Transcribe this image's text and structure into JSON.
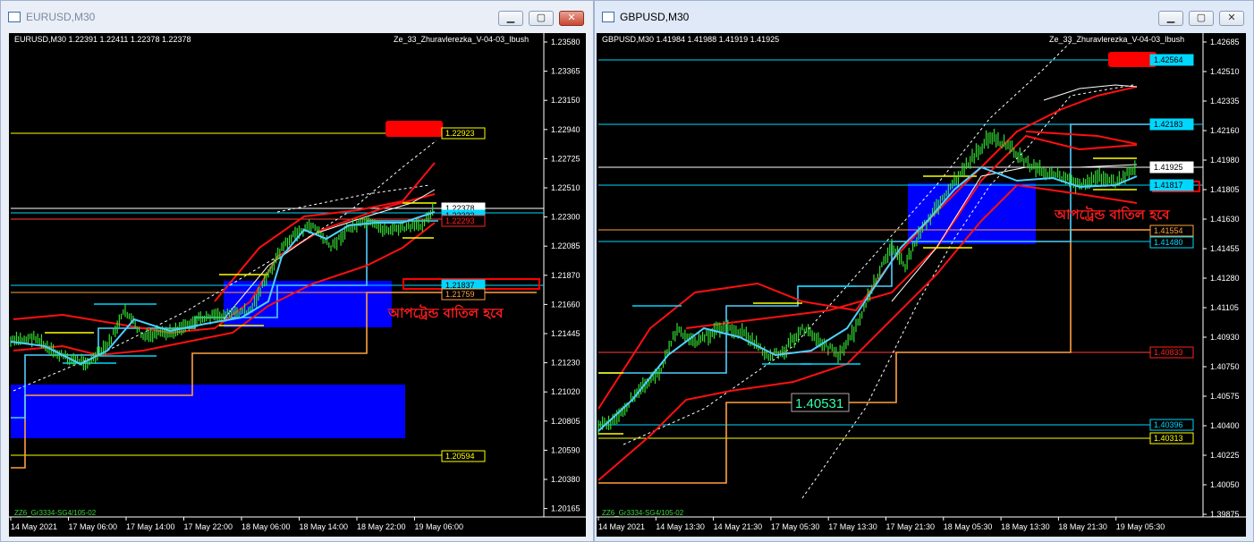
{
  "left": {
    "window_title": "EURUSD,M30",
    "info_line": "EURUSD,M30  1.22391 1.22411 1.22378 1.22378",
    "indicator_name": "Ze_33_Zhuravlerezka_V-04-03_Ibush",
    "footer": "ZZ6_Gr3334-SG4/105-02",
    "annotation": "আপট্রেন্ড বাতিল হবে",
    "price_axis": [
      "1.23580",
      "1.23365",
      "1.23150",
      "1.22940",
      "1.22725",
      "1.22510",
      "1.22300",
      "1.22085",
      "1.21870",
      "1.21660",
      "1.21445",
      "1.21230",
      "1.21020",
      "1.20805",
      "1.20590",
      "1.20380",
      "1.20165"
    ],
    "level_labels": [
      {
        "text": "1.22923",
        "color": "#ffff00"
      },
      {
        "text": "1.22378",
        "color": "#ffffff"
      },
      {
        "text": "1.22333",
        "color": "#00d7ff"
      },
      {
        "text": "1.22293",
        "color": "#ff2020"
      },
      {
        "text": "1.21837",
        "color": "#00d7ff"
      },
      {
        "text": "1.21759",
        "color": "#ffa040"
      },
      {
        "text": "1.20594",
        "color": "#ffff00"
      }
    ],
    "time_axis": [
      "14 May 2021",
      "17 May 06:00",
      "17 May 14:00",
      "17 May 22:00",
      "18 May 06:00",
      "18 May 14:00",
      "18 May 22:00",
      "19 May 06:00"
    ]
  },
  "right": {
    "window_title": "GBPUSD,M30",
    "info_line": "GBPUSD,M30  1.41984 1.41988 1.41919 1.41925",
    "indicator_name": "Ze_33_Zhuravlerezka_V-04-03_Ibush",
    "footer": "ZZ6_Gr3334-SG4/105-02",
    "annotation": "আপট্রেন্ড বাতিল হবে",
    "box_label": "1.40531",
    "price_axis": [
      "1.42685",
      "1.42510",
      "1.42335",
      "1.42160",
      "1.41980",
      "1.41805",
      "1.41630",
      "1.41455",
      "1.41280",
      "1.41105",
      "1.40930",
      "1.40750",
      "1.40575",
      "1.40400",
      "1.40225",
      "1.40050",
      "1.39875"
    ],
    "level_labels": [
      {
        "text": "1.42564",
        "color": "#00d7ff"
      },
      {
        "text": "1.42183",
        "color": "#00d7ff"
      },
      {
        "text": "1.41925",
        "color": "#ffffff"
      },
      {
        "text": "1.41817",
        "color": "#00d7ff"
      },
      {
        "text": "1.41554",
        "color": "#ffa040"
      },
      {
        "text": "1.41480",
        "color": "#00d7ff"
      },
      {
        "text": "1.40833",
        "color": "#ff2020"
      },
      {
        "text": "1.40396",
        "color": "#00d7ff"
      },
      {
        "text": "1.40313",
        "color": "#ffff00"
      }
    ],
    "time_axis": [
      "14 May 2021",
      "14 May 13:30",
      "14 May 21:30",
      "17 May 05:30",
      "17 May 13:30",
      "17 May 21:30",
      "18 May 05:30",
      "18 May 13:30",
      "18 May 21:30",
      "19 May 05:30"
    ]
  }
}
